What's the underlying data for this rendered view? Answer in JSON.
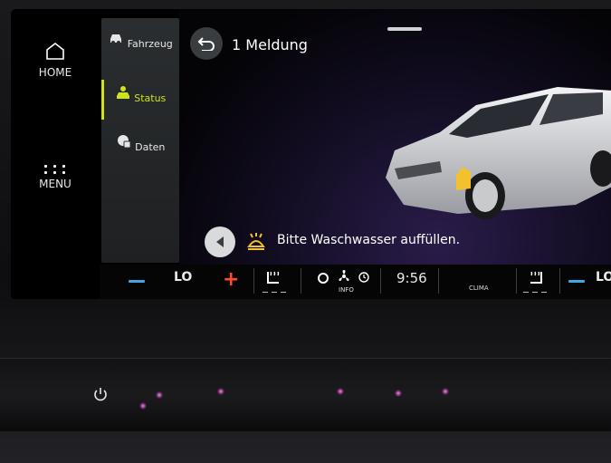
{
  "global_nav": {
    "home_label": "HOME",
    "menu_label": "MENU"
  },
  "vehicle_menu": {
    "items": [
      {
        "label": "Fahrzeug",
        "icon": "car-icon",
        "active": false
      },
      {
        "label": "Status",
        "icon": "car-status-icon",
        "active": true
      },
      {
        "label": "Daten",
        "icon": "data-icon",
        "active": false
      }
    ]
  },
  "header": {
    "title": "1 Meldung"
  },
  "message": {
    "text": "Bitte Waschwasser auffüllen.",
    "icon": "washer-fluid-warning-icon",
    "icon_color": "#f2c12e"
  },
  "climate": {
    "left_temp": "LO",
    "right_temp": "LO",
    "time": "9:56",
    "info_label": "INFO",
    "clima_label": "CLIMA"
  },
  "colors": {
    "accent": "#cfe21e",
    "minus": "#3fa6e8",
    "plus": "#ff4c28"
  }
}
